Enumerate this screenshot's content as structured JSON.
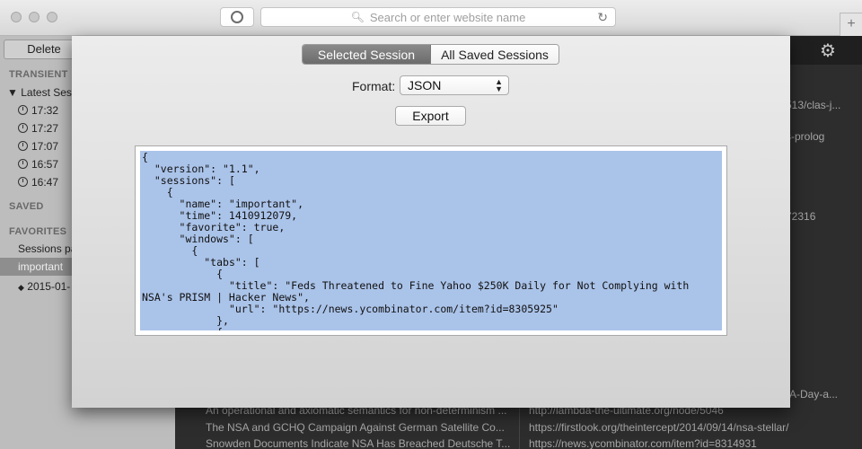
{
  "browser": {
    "address_placeholder": "Search or enter website name",
    "newtab_symbol": "+"
  },
  "sidebar": {
    "delete_label": "Delete",
    "transient_heading": "TRANSIENT",
    "latest_session": "Latest Sess",
    "times": [
      "17:32",
      "17:27",
      "17:07",
      "16:57",
      "16:47"
    ],
    "saved_heading": "SAVED",
    "favorites_heading": "FAVORITES",
    "favorites": [
      "Sessions pa",
      "important"
    ],
    "date_item": "2015-01-"
  },
  "content": {
    "fragments": [
      "513/clas-j...",
      "s-prolog",
      "72316",
      "-A-Day-a..."
    ],
    "rows": [
      {
        "title": "An operational and axiomatic semantics for non-determinism ...",
        "url": "http://lambda-the-ultimate.org/node/5046"
      },
      {
        "title": "The NSA and GCHQ Campaign Against German Satellite Co...",
        "url": "https://firstlook.org/theintercept/2014/09/14/nsa-stellar/"
      },
      {
        "title": "Snowden Documents Indicate NSA Has Breached Deutsche T...",
        "url": "https://news.ycombinator.com/item?id=8314931"
      }
    ]
  },
  "dialog": {
    "tab_selected": "Selected Session",
    "tab_all": "All Saved Sessions",
    "format_label": "Format:",
    "format_value": "JSON",
    "export_label": "Export",
    "json_text": "{\n  \"version\": \"1.1\",\n  \"sessions\": [\n    {\n      \"name\": \"important\",\n      \"time\": 1410912079,\n      \"favorite\": true,\n      \"windows\": [\n        {\n          \"tabs\": [\n            {\n              \"title\": \"Feds Threatened to Fine Yahoo $250K Daily for Not Complying with NSA's PRISM | Hacker News\",\n              \"url\": \"https://news.ycombinator.com/item?id=8305925\"\n            },\n            {"
  }
}
